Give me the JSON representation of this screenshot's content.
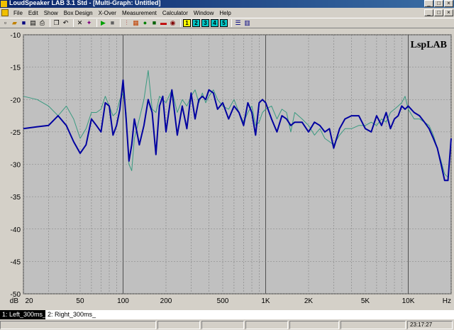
{
  "window": {
    "title": "LoudSpeaker LAB 3.1 Std - [Multi-Graph: Untitled]",
    "buttons": {
      "minimize": "_",
      "maximize": "□",
      "close": "×"
    }
  },
  "menu": [
    "File",
    "Edit",
    "Show",
    "Box Design",
    "X-Over",
    "Measurement",
    "Calculator",
    "Window",
    "Help"
  ],
  "toolbar": {
    "numbers": [
      "1",
      "2",
      "3",
      "4",
      "5"
    ]
  },
  "graph": {
    "watermark": "LspLAB",
    "unit_y": "dB",
    "unit_x": "Hz",
    "colors": {
      "background": "#c0c0c0",
      "grid": "#808080",
      "major": "#505050",
      "left": "#0000a0",
      "right": "#3a9a80"
    }
  },
  "chart_data": {
    "type": "line",
    "xscale": "log",
    "xlim": [
      20,
      20000
    ],
    "ylim": [
      -50,
      -10
    ],
    "xticks": [
      20,
      50,
      100,
      200,
      500,
      1000,
      2000,
      5000,
      10000
    ],
    "xticklabels": [
      "20",
      "50",
      "100",
      "200",
      "500",
      "1K",
      "2K",
      "5K",
      "10K"
    ],
    "yticks": [
      -10,
      -15,
      -20,
      -25,
      -30,
      -35,
      -40,
      -45,
      -50
    ],
    "xlabel": "Hz",
    "ylabel": "dB",
    "grid": true,
    "series": [
      {
        "name": "1: Left_300ms_",
        "color": "#0000a0",
        "x": [
          20,
          25,
          30,
          35,
          40,
          45,
          50,
          55,
          60,
          65,
          70,
          75,
          80,
          85,
          90,
          95,
          100,
          105,
          110,
          115,
          120,
          130,
          140,
          150,
          160,
          170,
          180,
          190,
          200,
          220,
          240,
          260,
          280,
          300,
          320,
          340,
          360,
          380,
          400,
          430,
          460,
          500,
          550,
          600,
          650,
          700,
          750,
          800,
          850,
          900,
          950,
          1000,
          1100,
          1200,
          1300,
          1400,
          1500,
          1600,
          1800,
          2000,
          2200,
          2400,
          2600,
          2800,
          3000,
          3300,
          3600,
          4000,
          4500,
          5000,
          5500,
          6000,
          6500,
          7000,
          7500,
          8000,
          8500,
          9000,
          9500,
          10000,
          11000,
          12000,
          13000,
          14000,
          15000,
          16000,
          17000,
          18000,
          19000,
          20000
        ],
        "y": [
          -24.5,
          -24.2,
          -24,
          -22.5,
          -24,
          -26.5,
          -28.3,
          -27,
          -23,
          -24,
          -25,
          -20.5,
          -21,
          -25.5,
          -24,
          -21.5,
          -17,
          -23,
          -29.5,
          -27,
          -23,
          -27,
          -24,
          -20,
          -22,
          -28.5,
          -21,
          -19.5,
          -25,
          -18.5,
          -25.5,
          -21,
          -24.5,
          -19,
          -23,
          -20,
          -19.5,
          -20,
          -18.5,
          -19,
          -21.5,
          -20.5,
          -23,
          -21,
          -22,
          -24,
          -20.5,
          -22,
          -25.5,
          -20.5,
          -20,
          -20.5,
          -23,
          -25,
          -22.5,
          -23,
          -24,
          -23.5,
          -23.5,
          -25,
          -23.5,
          -24,
          -25,
          -24.5,
          -27.5,
          -24.5,
          -23,
          -22.5,
          -22.5,
          -24.5,
          -25,
          -22.5,
          -24,
          -22,
          -24.5,
          -23,
          -22.5,
          -21,
          -21.5,
          -21,
          -22,
          -22.5,
          -23.5,
          -24.5,
          -26,
          -27.5,
          -30,
          -32.5,
          -32.5,
          -26
        ]
      },
      {
        "name": "2: Right_300ms_",
        "color": "#3a9a80",
        "x": [
          20,
          25,
          30,
          35,
          40,
          45,
          50,
          55,
          60,
          65,
          70,
          75,
          80,
          85,
          90,
          95,
          100,
          105,
          110,
          115,
          120,
          130,
          140,
          150,
          160,
          170,
          180,
          190,
          200,
          220,
          240,
          260,
          280,
          300,
          320,
          340,
          360,
          380,
          400,
          430,
          460,
          500,
          550,
          600,
          650,
          700,
          750,
          800,
          850,
          900,
          950,
          1000,
          1100,
          1200,
          1300,
          1400,
          1500,
          1600,
          1800,
          2000,
          2200,
          2400,
          2600,
          2800,
          3000,
          3300,
          3600,
          4000,
          4500,
          5000,
          5500,
          6000,
          6500,
          7000,
          7500,
          8000,
          8500,
          9000,
          9500,
          10000,
          11000,
          12000,
          13000,
          14000,
          15000,
          16000,
          17000,
          18000,
          19000,
          20000
        ],
        "y": [
          -19.5,
          -20,
          -21,
          -22.5,
          -21,
          -23,
          -26,
          -24.5,
          -22,
          -22,
          -21.5,
          -19.5,
          -21,
          -22.5,
          -22,
          -20,
          -19,
          -22,
          -30,
          -31,
          -26,
          -23,
          -20,
          -15.5,
          -21.5,
          -22,
          -19.5,
          -20,
          -20.5,
          -18.5,
          -22,
          -20,
          -21,
          -19.5,
          -18.5,
          -20.5,
          -19,
          -20.5,
          -19.5,
          -18.5,
          -20,
          -21,
          -21.5,
          -20,
          -22,
          -23.5,
          -22,
          -21,
          -24,
          -23.5,
          -22,
          -21.5,
          -21,
          -23,
          -21.5,
          -22,
          -25,
          -22,
          -23,
          -24,
          -25.5,
          -24.5,
          -26,
          -26.5,
          -27,
          -25.5,
          -24.5,
          -24.5,
          -24,
          -24,
          -23.5,
          -24,
          -23,
          -23.5,
          -22,
          -21.5,
          -21,
          -20.5,
          -19.5,
          -21.5,
          -23,
          -23,
          -23.5,
          -24,
          -25.5,
          -27.5,
          -29.5,
          -31.5,
          -32,
          -26
        ]
      }
    ]
  },
  "status": {
    "time": "23:17:27"
  }
}
